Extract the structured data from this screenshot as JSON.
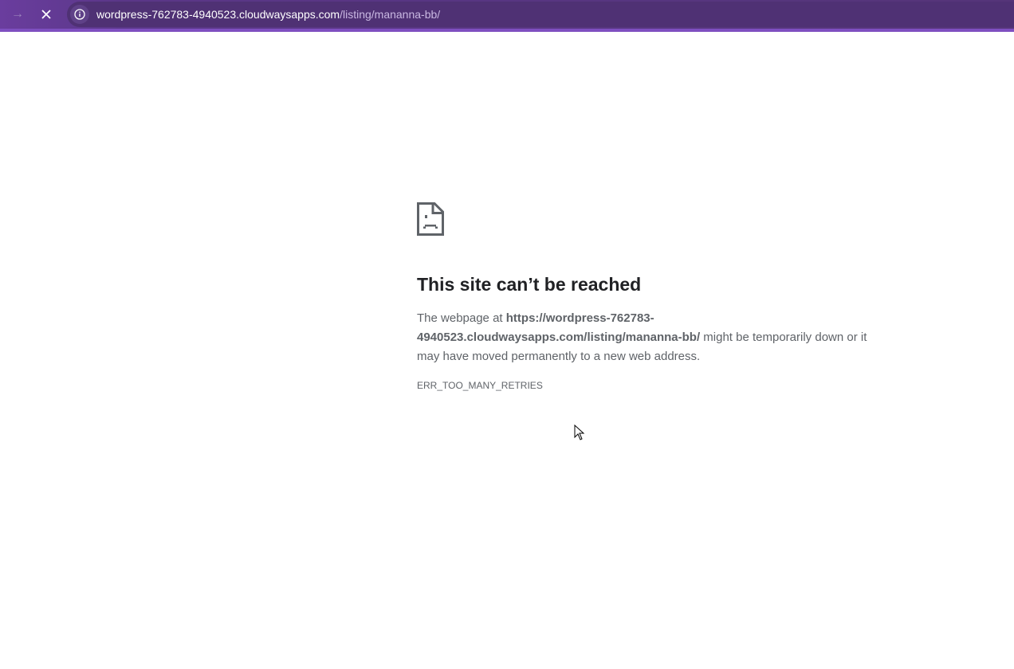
{
  "browser": {
    "url_host": "wordpress-762783-4940523.cloudwaysapps.com",
    "url_path": "/listing/mananna-bb/",
    "forward_icon": "arrow-right-icon",
    "stop_icon": "close-icon",
    "info_icon": "info-icon"
  },
  "error": {
    "icon": "sad-page-icon",
    "title": "This site can’t be reached",
    "body_prefix": "The webpage at ",
    "body_url": "https://wordpress-762783-4940523.cloudwaysapps.com/listing/mananna-bb/",
    "body_suffix": " might be temporarily down or it may have moved permanently to a new web address.",
    "code": "ERR_TOO_MANY_RETRIES"
  },
  "colors": {
    "toolbar": "#553579",
    "loadbar": "#7e4fc0",
    "heading": "#202124",
    "text": "#5f6368"
  }
}
